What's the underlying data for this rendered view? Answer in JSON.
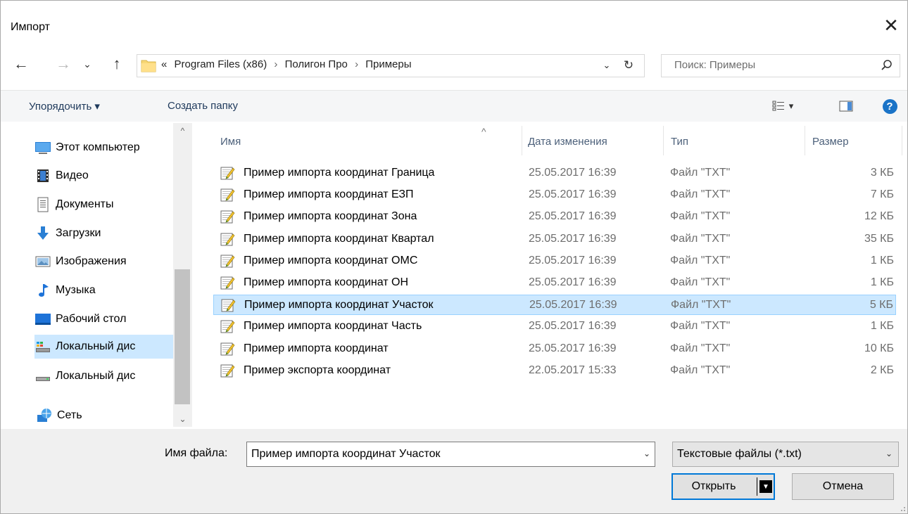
{
  "window": {
    "title": "Импорт",
    "close_glyph": "✕"
  },
  "nav": {
    "back_glyph": "←",
    "forward_glyph": "→",
    "history_glyph": "⌄",
    "up_glyph": "↑",
    "breadcrumb": [
      "«",
      "Program Files (x86)",
      "›",
      "Полигон Про",
      "›",
      "Примеры"
    ],
    "drop_glyph": "⌄",
    "refresh_glyph": "↻",
    "search_placeholder": "Поиск: Примеры"
  },
  "toolbar": {
    "organize_label": "Упорядочить ▾",
    "new_folder_label": "Создать папку",
    "view_drop_glyph": "▾",
    "help_glyph": "?"
  },
  "sidebar": {
    "items": [
      {
        "label": "Этот компьютер",
        "icon": "computer-icon"
      },
      {
        "label": "Видео",
        "icon": "video-icon"
      },
      {
        "label": "Документы",
        "icon": "documents-icon"
      },
      {
        "label": "Загрузки",
        "icon": "downloads-icon"
      },
      {
        "label": "Изображения",
        "icon": "pictures-icon"
      },
      {
        "label": "Музыка",
        "icon": "music-icon"
      },
      {
        "label": "Рабочий стол",
        "icon": "desktop-icon"
      },
      {
        "label": "Локальный дис",
        "icon": "local-disk-icon"
      },
      {
        "label": "Локальный дис",
        "icon": "local-disk-icon"
      },
      {
        "label": "Сеть",
        "icon": "network-icon"
      }
    ],
    "scroll_up_glyph": "^",
    "scroll_down_glyph": "⌄"
  },
  "columns": {
    "name": "Имя",
    "date": "Дата изменения",
    "type": "Тип",
    "size": "Размер",
    "sort_glyph": "^"
  },
  "files": [
    {
      "name": "Пример импорта координат Граница",
      "date": "25.05.2017 16:39",
      "type": "Файл \"TXT\"",
      "size": "3 КБ"
    },
    {
      "name": "Пример импорта координат ЕЗП",
      "date": "25.05.2017 16:39",
      "type": "Файл \"TXT\"",
      "size": "7 КБ"
    },
    {
      "name": "Пример импорта координат Зона",
      "date": "25.05.2017 16:39",
      "type": "Файл \"TXT\"",
      "size": "12 КБ"
    },
    {
      "name": "Пример импорта координат Квартал",
      "date": "25.05.2017 16:39",
      "type": "Файл \"TXT\"",
      "size": "35 КБ"
    },
    {
      "name": "Пример импорта координат ОМС",
      "date": "25.05.2017 16:39",
      "type": "Файл \"TXT\"",
      "size": "1 КБ"
    },
    {
      "name": "Пример импорта координат ОН",
      "date": "25.05.2017 16:39",
      "type": "Файл \"TXT\"",
      "size": "1 КБ"
    },
    {
      "name": "Пример импорта координат Участок",
      "date": "25.05.2017 16:39",
      "type": "Файл \"TXT\"",
      "size": "5 КБ"
    },
    {
      "name": "Пример импорта координат Часть",
      "date": "25.05.2017 16:39",
      "type": "Файл \"TXT\"",
      "size": "1 КБ"
    },
    {
      "name": "Пример импорта координат",
      "date": "25.05.2017 16:39",
      "type": "Файл \"TXT\"",
      "size": "10 КБ"
    },
    {
      "name": "Пример экспорта координат",
      "date": "22.05.2017 15:33",
      "type": "Файл \"TXT\"",
      "size": "2 КБ"
    }
  ],
  "footer": {
    "filename_label": "Имя файла:",
    "filename_value": "Пример импорта координат Участок",
    "filetype_value": "Текстовые файлы (*.txt)",
    "dropdown_glyph": "⌄",
    "open_label": "Открыть",
    "open_arrow_glyph": "▼",
    "cancel_label": "Отмена"
  },
  "colors": {
    "selection_bg": "#cce8ff",
    "selection_border": "#99d1ff",
    "accent": "#0078d7",
    "help_blue": "#1a73c7"
  }
}
